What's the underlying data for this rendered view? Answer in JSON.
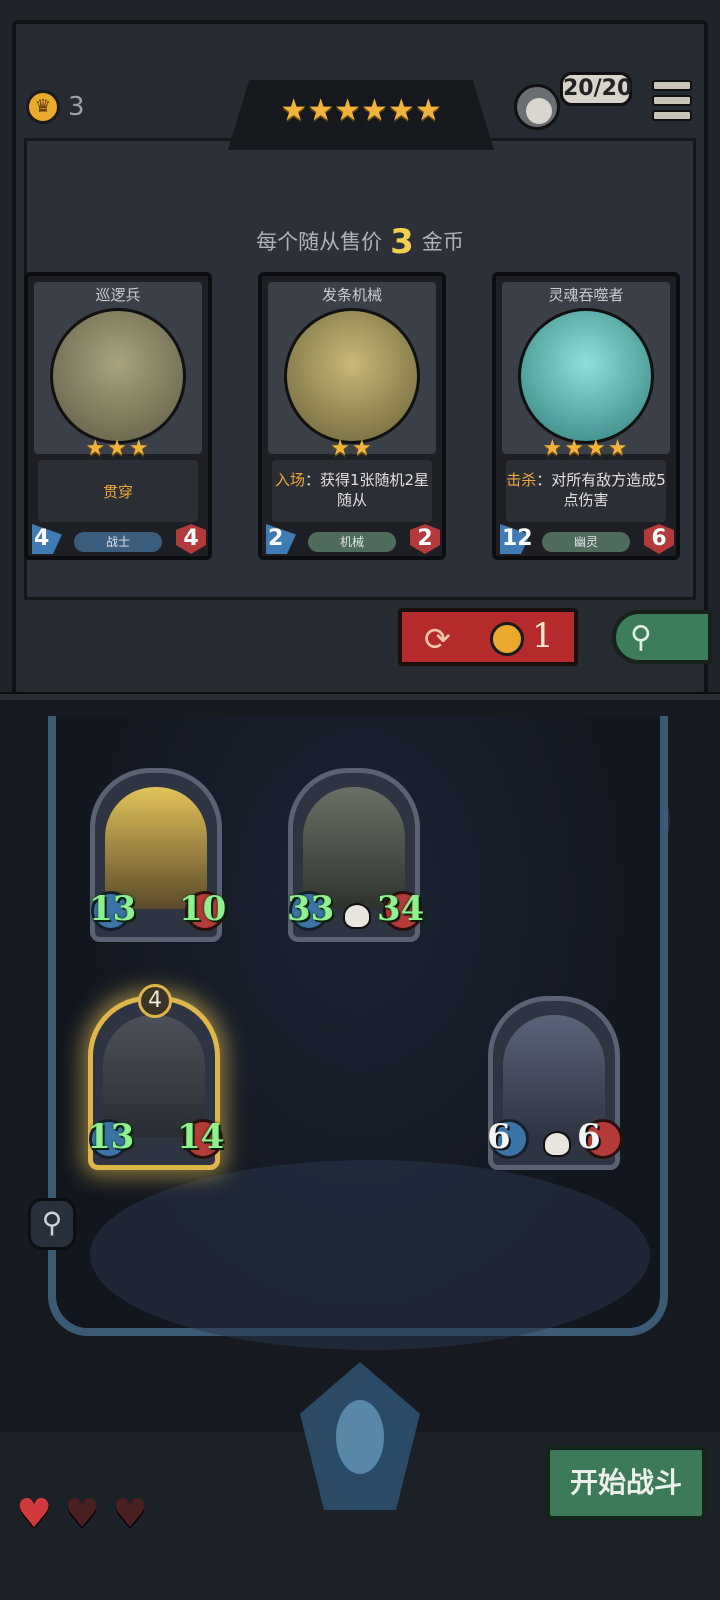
{
  "header": {
    "gold": "3",
    "tier_stars": 6,
    "population": "20/20"
  },
  "shop": {
    "price_prefix": "每个随从售价",
    "price_value": "3",
    "price_suffix": "金币",
    "cards": [
      {
        "name": "巡逻兵",
        "stars": "★★★",
        "keyword": "",
        "desc": "贯穿",
        "attack": "4",
        "health": "4",
        "tribe": "战士",
        "tribe_color": "#3a5d7d",
        "art_color": "#8a8467"
      },
      {
        "name": "发条机械",
        "stars": "★★",
        "keyword": "入场",
        "desc": "：获得1张随机2星随从",
        "attack": "2",
        "health": "2",
        "tribe": "机械",
        "tribe_color": "#4f6b5c",
        "art_color": "#a89a5c"
      },
      {
        "name": "灵魂吞噬者",
        "stars": "★★★★",
        "keyword": "击杀",
        "desc": "：对所有敌方造成5点伤害",
        "attack": "12",
        "health": "6",
        "tribe": "幽灵",
        "tribe_color": "#4f6b5c",
        "art_color": "#4fb3b0"
      }
    ],
    "refresh_cost": "1"
  },
  "board": {
    "units": [
      {
        "attack": "13",
        "health": "10",
        "highlight": false,
        "art_color": "#c9a544"
      },
      {
        "attack": "33",
        "health": "34",
        "highlight": false,
        "art_color": "#555a52"
      },
      {
        "attack": "13",
        "health": "14",
        "highlight": true,
        "badge": "4",
        "art_color": "#3f434c"
      },
      {
        "attack": "6",
        "health": "6",
        "highlight": false,
        "art_color": "#4d5668"
      }
    ]
  },
  "hearts": {
    "total": 3,
    "filled": 1
  },
  "start_button": "开始战斗",
  "colors": {
    "gold": "#e8a92c",
    "refresh": "#b52a2a",
    "start": "#3d7a5a",
    "stat_green": "#8ff08f"
  }
}
